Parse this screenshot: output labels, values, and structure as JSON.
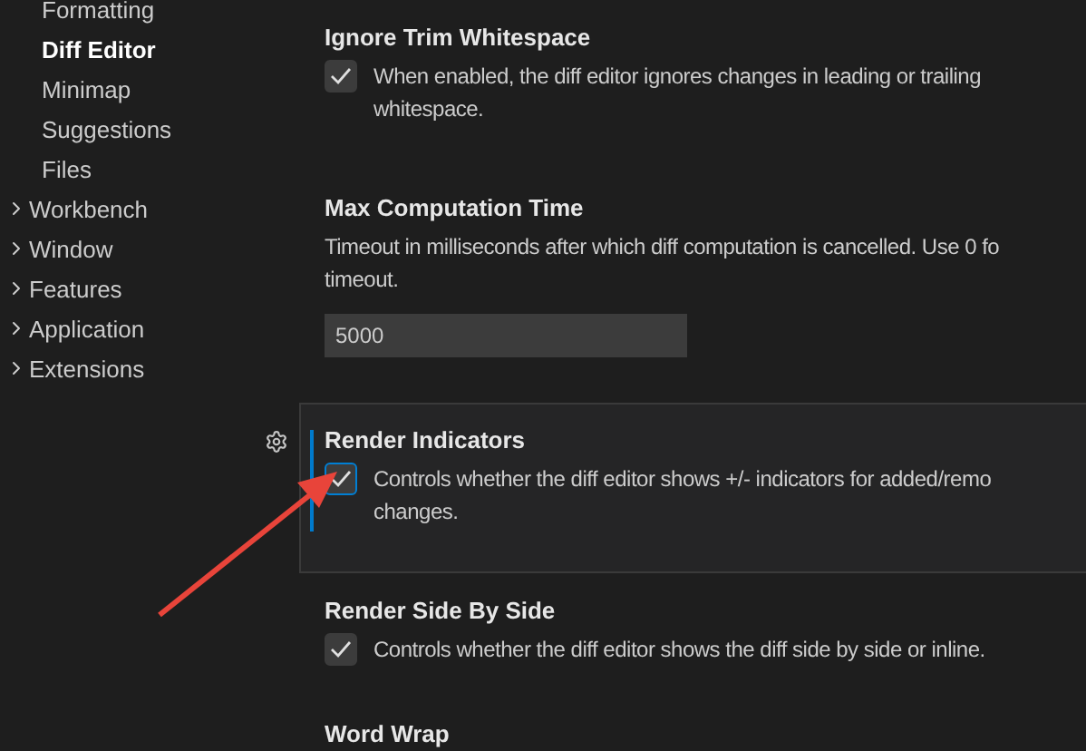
{
  "sidebar": {
    "items": [
      {
        "label": "Formatting",
        "selected": false
      },
      {
        "label": "Diff Editor",
        "selected": true
      },
      {
        "label": "Minimap",
        "selected": false
      },
      {
        "label": "Suggestions",
        "selected": false
      },
      {
        "label": "Files",
        "selected": false
      },
      {
        "label": "Workbench",
        "selected": false,
        "expanded": false
      },
      {
        "label": "Window",
        "selected": false,
        "expanded": false
      },
      {
        "label": "Features",
        "selected": false,
        "expanded": false
      },
      {
        "label": "Application",
        "selected": false,
        "expanded": false
      },
      {
        "label": "Extensions",
        "selected": false,
        "expanded": false
      }
    ]
  },
  "settings": [
    {
      "kind": "checkbox",
      "title": "Ignore Trim Whitespace",
      "description": [
        "When enabled, the diff editor ignores changes in leading or trailing",
        "whitespace."
      ],
      "checked": true,
      "focused": false
    },
    {
      "kind": "number",
      "title": "Max Computation Time",
      "description": [
        "Timeout in milliseconds after which diff computation is cancelled. Use 0 fo",
        "timeout."
      ],
      "value": "5000",
      "focused": false
    },
    {
      "kind": "checkbox",
      "title": "Render Indicators",
      "description": [
        "Controls whether the diff editor shows +/- indicators for added/remo",
        "changes."
      ],
      "checked": true,
      "focused": true
    },
    {
      "kind": "checkbox",
      "title": "Render Side By Side",
      "description": [
        "Controls whether the diff editor shows the diff side by side or inline."
      ],
      "checked": true,
      "focused": false
    },
    {
      "kind": "heading",
      "title": "Word Wrap",
      "focused": false
    }
  ]
}
